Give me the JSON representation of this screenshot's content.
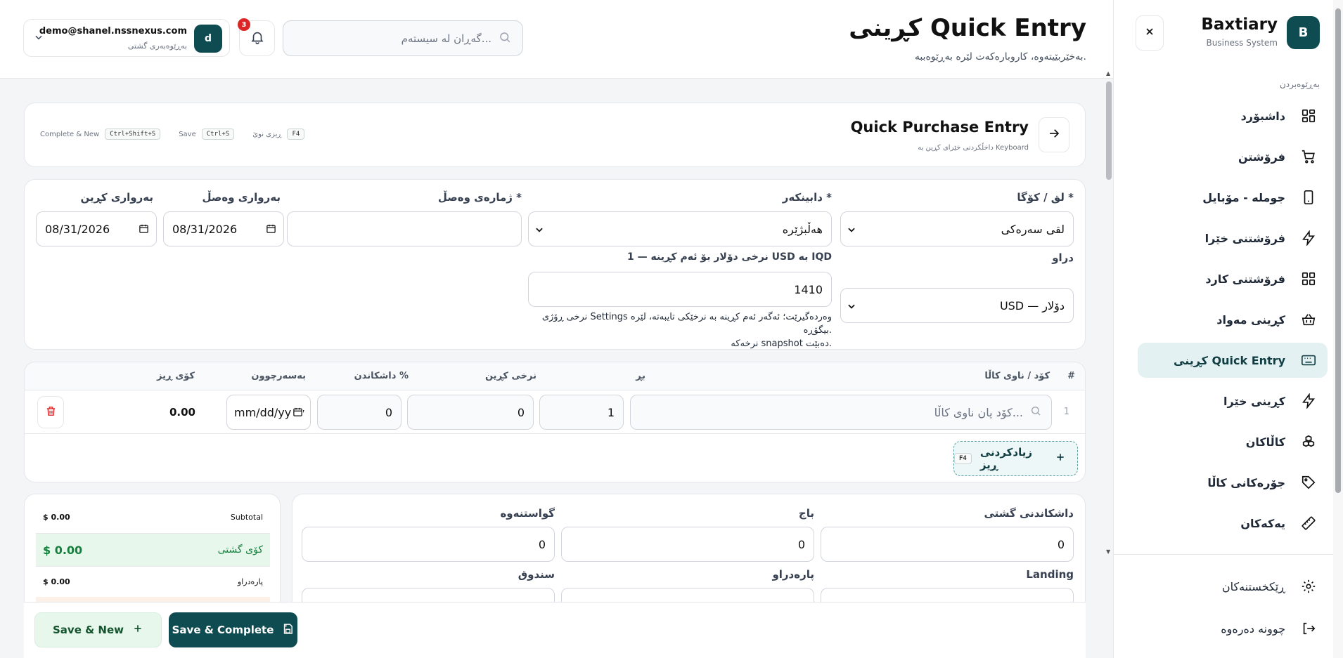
{
  "sidebar": {
    "brand_name": "Baxtiary",
    "brand_sub": "Business System",
    "logo_letter": "B",
    "section_label": "بەڕێوەبردن",
    "items": [
      {
        "label": "داشبۆرد",
        "icon": "dashboard-grid-icon"
      },
      {
        "label": "فرۆشتن",
        "icon": "cart-icon"
      },
      {
        "label": "جوملە - مۆبایل",
        "icon": "mobile-icon"
      },
      {
        "label": "فرۆشتنی خێرا",
        "icon": "lightning-icon"
      },
      {
        "label": "فرۆشتنی کارد",
        "icon": "cards-grid-icon"
      },
      {
        "label": "کڕینی مەواد",
        "icon": "basket-icon"
      },
      {
        "label": "کڕینی Quick Entry",
        "icon": "keyboard-icon",
        "active": true
      },
      {
        "label": "کڕینی خێرا",
        "icon": "lightning-icon"
      },
      {
        "label": "کاڵاکان",
        "icon": "boxes-icon"
      },
      {
        "label": "جۆرەکانی کاڵا",
        "icon": "tag-icon"
      },
      {
        "label": "یەکەکان",
        "icon": "ruler-icon"
      }
    ],
    "settings_label": "ڕێکخستنەکان",
    "logout_label": "چوونە دەرەوە"
  },
  "header": {
    "title": "کڕینی Quick Entry",
    "subtitle": "بەخێربێیتەوە، کاروبارەکەت لێرە بەڕێوەببە.",
    "search_placeholder": "گەڕان لە سیستەم...",
    "notification_count": "3",
    "user_email": "demo@shanel.nssnexus.com",
    "user_role": "بەڕێوەبەری گشتی",
    "user_initial": "d"
  },
  "quick_entry": {
    "title": "Quick Purchase Entry",
    "subtitle": "داخڵکردنی خێرای کڕین بە Keyboard",
    "shortcuts": [
      {
        "label": "ڕیزی نوێ",
        "key": "F4"
      },
      {
        "label": "Save",
        "key": "Ctrl+S"
      },
      {
        "label": "Complete & New",
        "key": "Ctrl+Shift+S"
      }
    ]
  },
  "form": {
    "branch_label": "لق / کۆگا *",
    "branch_value": "لقی سەرەکی",
    "supplier_label": "دابینکەر *",
    "supplier_value": "هەڵبژێرە",
    "invoice_no_label": "ژمارەی وەصڵ *",
    "invoice_no_value": "",
    "invoice_date_label": "بەرواری وەصڵ",
    "invoice_date_value": "08/31/2026",
    "purchase_date_label": "بەرواری کڕین",
    "purchase_date_value": "08/31/2026",
    "currency_label": "دراو",
    "currency_value": "USD — دۆلار",
    "rate_label": "نرخی دۆلار بۆ ئەم کڕینە — 1 USD بە IQD",
    "rate_value": "1410",
    "rate_hint_line1": "نرخی ڕۆژی Settings وەردەگیرێت؛ ئەگەر ئەم کڕینە بە نرخێکی تایبەتە، لێرە بیگۆڕە.",
    "rate_hint_line2": "نرخەکە snapshot دەبێت."
  },
  "items_table": {
    "headers": {
      "num": "#",
      "code": "کۆد / ناوی کاڵا",
      "qty": "بڕ",
      "price": "نرخی کڕین",
      "discount": "داشکاندن %",
      "expiry": "بەسەرچوون",
      "total": "کۆی ڕیز"
    },
    "rows": [
      {
        "num": "1",
        "code_placeholder": "کۆد یان ناوی کاڵا...",
        "qty": "1",
        "price": "0",
        "discount": "0",
        "expiry_placeholder": "mm/dd/yyyy",
        "total": "0.00"
      }
    ],
    "add_row_label": "زیادکردنی ڕیز",
    "add_row_key": "F4"
  },
  "summary": {
    "subtotal_label": "Subtotal",
    "subtotal_value": "$ 0.00",
    "grand_total_label": "کۆی گشتی",
    "grand_total_value": "$ 0.00",
    "paid_label": "پارەدراو",
    "paid_value": "$ 0.00"
  },
  "totals": {
    "discount_label": "داشکاندنی گشتی",
    "discount_value": "0",
    "tax_label": "باج",
    "tax_value": "0",
    "transport_label": "گواستنەوە",
    "transport_value": "0",
    "landing_label": "Landing",
    "paid_label": "پارەدراو",
    "cashbox_label": "سندوق"
  },
  "actions": {
    "save_new_label": "Save & New",
    "save_complete_label": "Save & Complete"
  },
  "colors": {
    "brand": "#0f4c52",
    "accent_light": "#e3f1f2",
    "success": "#15803d",
    "danger": "#dc2626"
  }
}
